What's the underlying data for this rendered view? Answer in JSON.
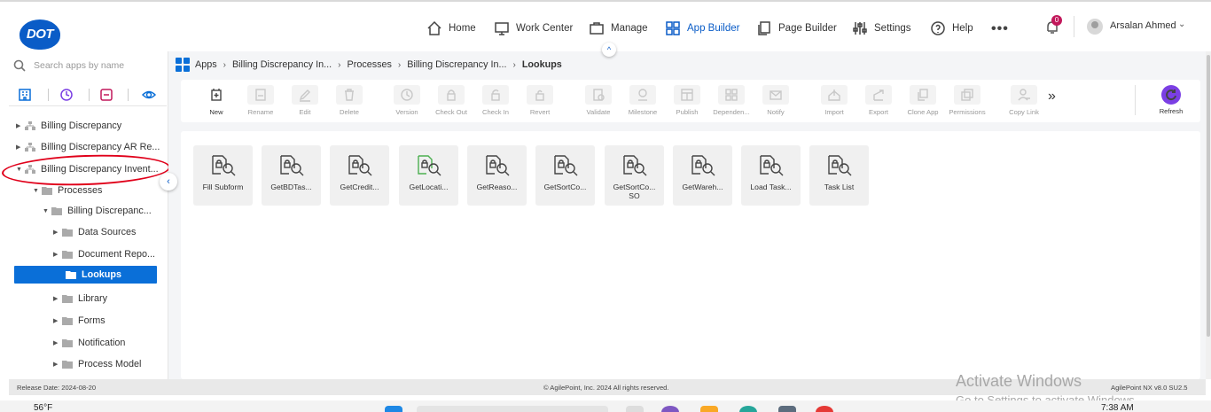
{
  "brand": {
    "logo_text": "DOT"
  },
  "nav": {
    "home": "Home",
    "work_center": "Work Center",
    "manage": "Manage",
    "app_builder": "App Builder",
    "page_builder": "Page Builder",
    "settings": "Settings",
    "help": "Help",
    "more": "•••",
    "notification_count": "0",
    "user_name": "Arsalan Ahmed"
  },
  "sidebar": {
    "search_placeholder": "Search apps by name",
    "tree": [
      {
        "label": "Billing Discrepancy",
        "type": "app",
        "expanded": false
      },
      {
        "label": "Billing Discrepancy AR Re...",
        "type": "app",
        "expanded": false
      },
      {
        "label": "Billing Discrepancy Invent...",
        "type": "app",
        "expanded": true
      },
      {
        "label": "Processes",
        "type": "folder",
        "expanded": true
      },
      {
        "label": "Billing Discrepanc...",
        "type": "folder",
        "expanded": true
      },
      {
        "label": "Data Sources",
        "type": "folder",
        "expanded": false
      },
      {
        "label": "Document Repo...",
        "type": "folder",
        "expanded": false
      },
      {
        "label": "Lookups",
        "type": "folder",
        "selected": true
      },
      {
        "label": "Library",
        "type": "folder",
        "expanded": false
      },
      {
        "label": "Forms",
        "type": "folder",
        "expanded": false
      },
      {
        "label": "Notification",
        "type": "folder",
        "expanded": false
      },
      {
        "label": "Process Model",
        "type": "folder",
        "expanded": false
      }
    ]
  },
  "breadcrumb": [
    "Apps",
    "Billing Discrepancy In...",
    "Processes",
    "Billing Discrepancy In...",
    "Lookups"
  ],
  "toolbar": {
    "buttons": [
      {
        "label": "New",
        "enabled": true,
        "icon": "new-icon"
      },
      {
        "label": "Rename",
        "enabled": false,
        "icon": "rename-icon"
      },
      {
        "label": "Edit",
        "enabled": false,
        "icon": "edit-icon"
      },
      {
        "label": "Delete",
        "enabled": false,
        "icon": "delete-icon"
      },
      {
        "label": "Version",
        "enabled": false,
        "icon": "version-icon"
      },
      {
        "label": "Check Out",
        "enabled": false,
        "icon": "check-out-icon"
      },
      {
        "label": "Check In",
        "enabled": false,
        "icon": "check-in-icon"
      },
      {
        "label": "Revert",
        "enabled": false,
        "icon": "revert-icon"
      },
      {
        "label": "Validate",
        "enabled": false,
        "icon": "validate-icon"
      },
      {
        "label": "Milestone",
        "enabled": false,
        "icon": "milestone-icon"
      },
      {
        "label": "Publish",
        "enabled": false,
        "icon": "publish-icon"
      },
      {
        "label": "Dependen...",
        "enabled": false,
        "icon": "dependencies-icon"
      },
      {
        "label": "Notify",
        "enabled": false,
        "icon": "notify-icon"
      },
      {
        "label": "Import",
        "enabled": false,
        "icon": "import-icon"
      },
      {
        "label": "Export",
        "enabled": false,
        "icon": "export-icon"
      },
      {
        "label": "Clone App",
        "enabled": false,
        "icon": "clone-icon"
      },
      {
        "label": "Permissions",
        "enabled": false,
        "icon": "permissions-icon"
      },
      {
        "label": "Copy Link",
        "enabled": false,
        "icon": "copy-link-icon"
      }
    ],
    "more": "»",
    "refresh": "Refresh"
  },
  "lookups": [
    {
      "label": "Fill Subform"
    },
    {
      "label": "GetBDTas..."
    },
    {
      "label": "GetCredit..."
    },
    {
      "label": "GetLocati...",
      "accent": "#4caf50"
    },
    {
      "label": "GetReaso..."
    },
    {
      "label": "GetSortCo..."
    },
    {
      "label": "GetSortCo... SO"
    },
    {
      "label": "GetWareh..."
    },
    {
      "label": "Load Task..."
    },
    {
      "label": "Task List"
    }
  ],
  "footer": {
    "release_date": "Release Date: 2024-08-20",
    "copyright": "© AgilePoint, Inc. 2024 All rights reserved.",
    "version": "AgilePoint NX v8.0 SU2.5"
  },
  "watermark": {
    "title": "Activate Windows",
    "subtitle": "Go to Settings to activate Windows."
  },
  "taskbar": {
    "weather": "56°F",
    "time": "7:38 AM"
  },
  "colors": {
    "accent": "#0a6fd8",
    "annotation": "#e0001a",
    "refresh": "#7b3fe4",
    "badge": "#c2185b"
  }
}
